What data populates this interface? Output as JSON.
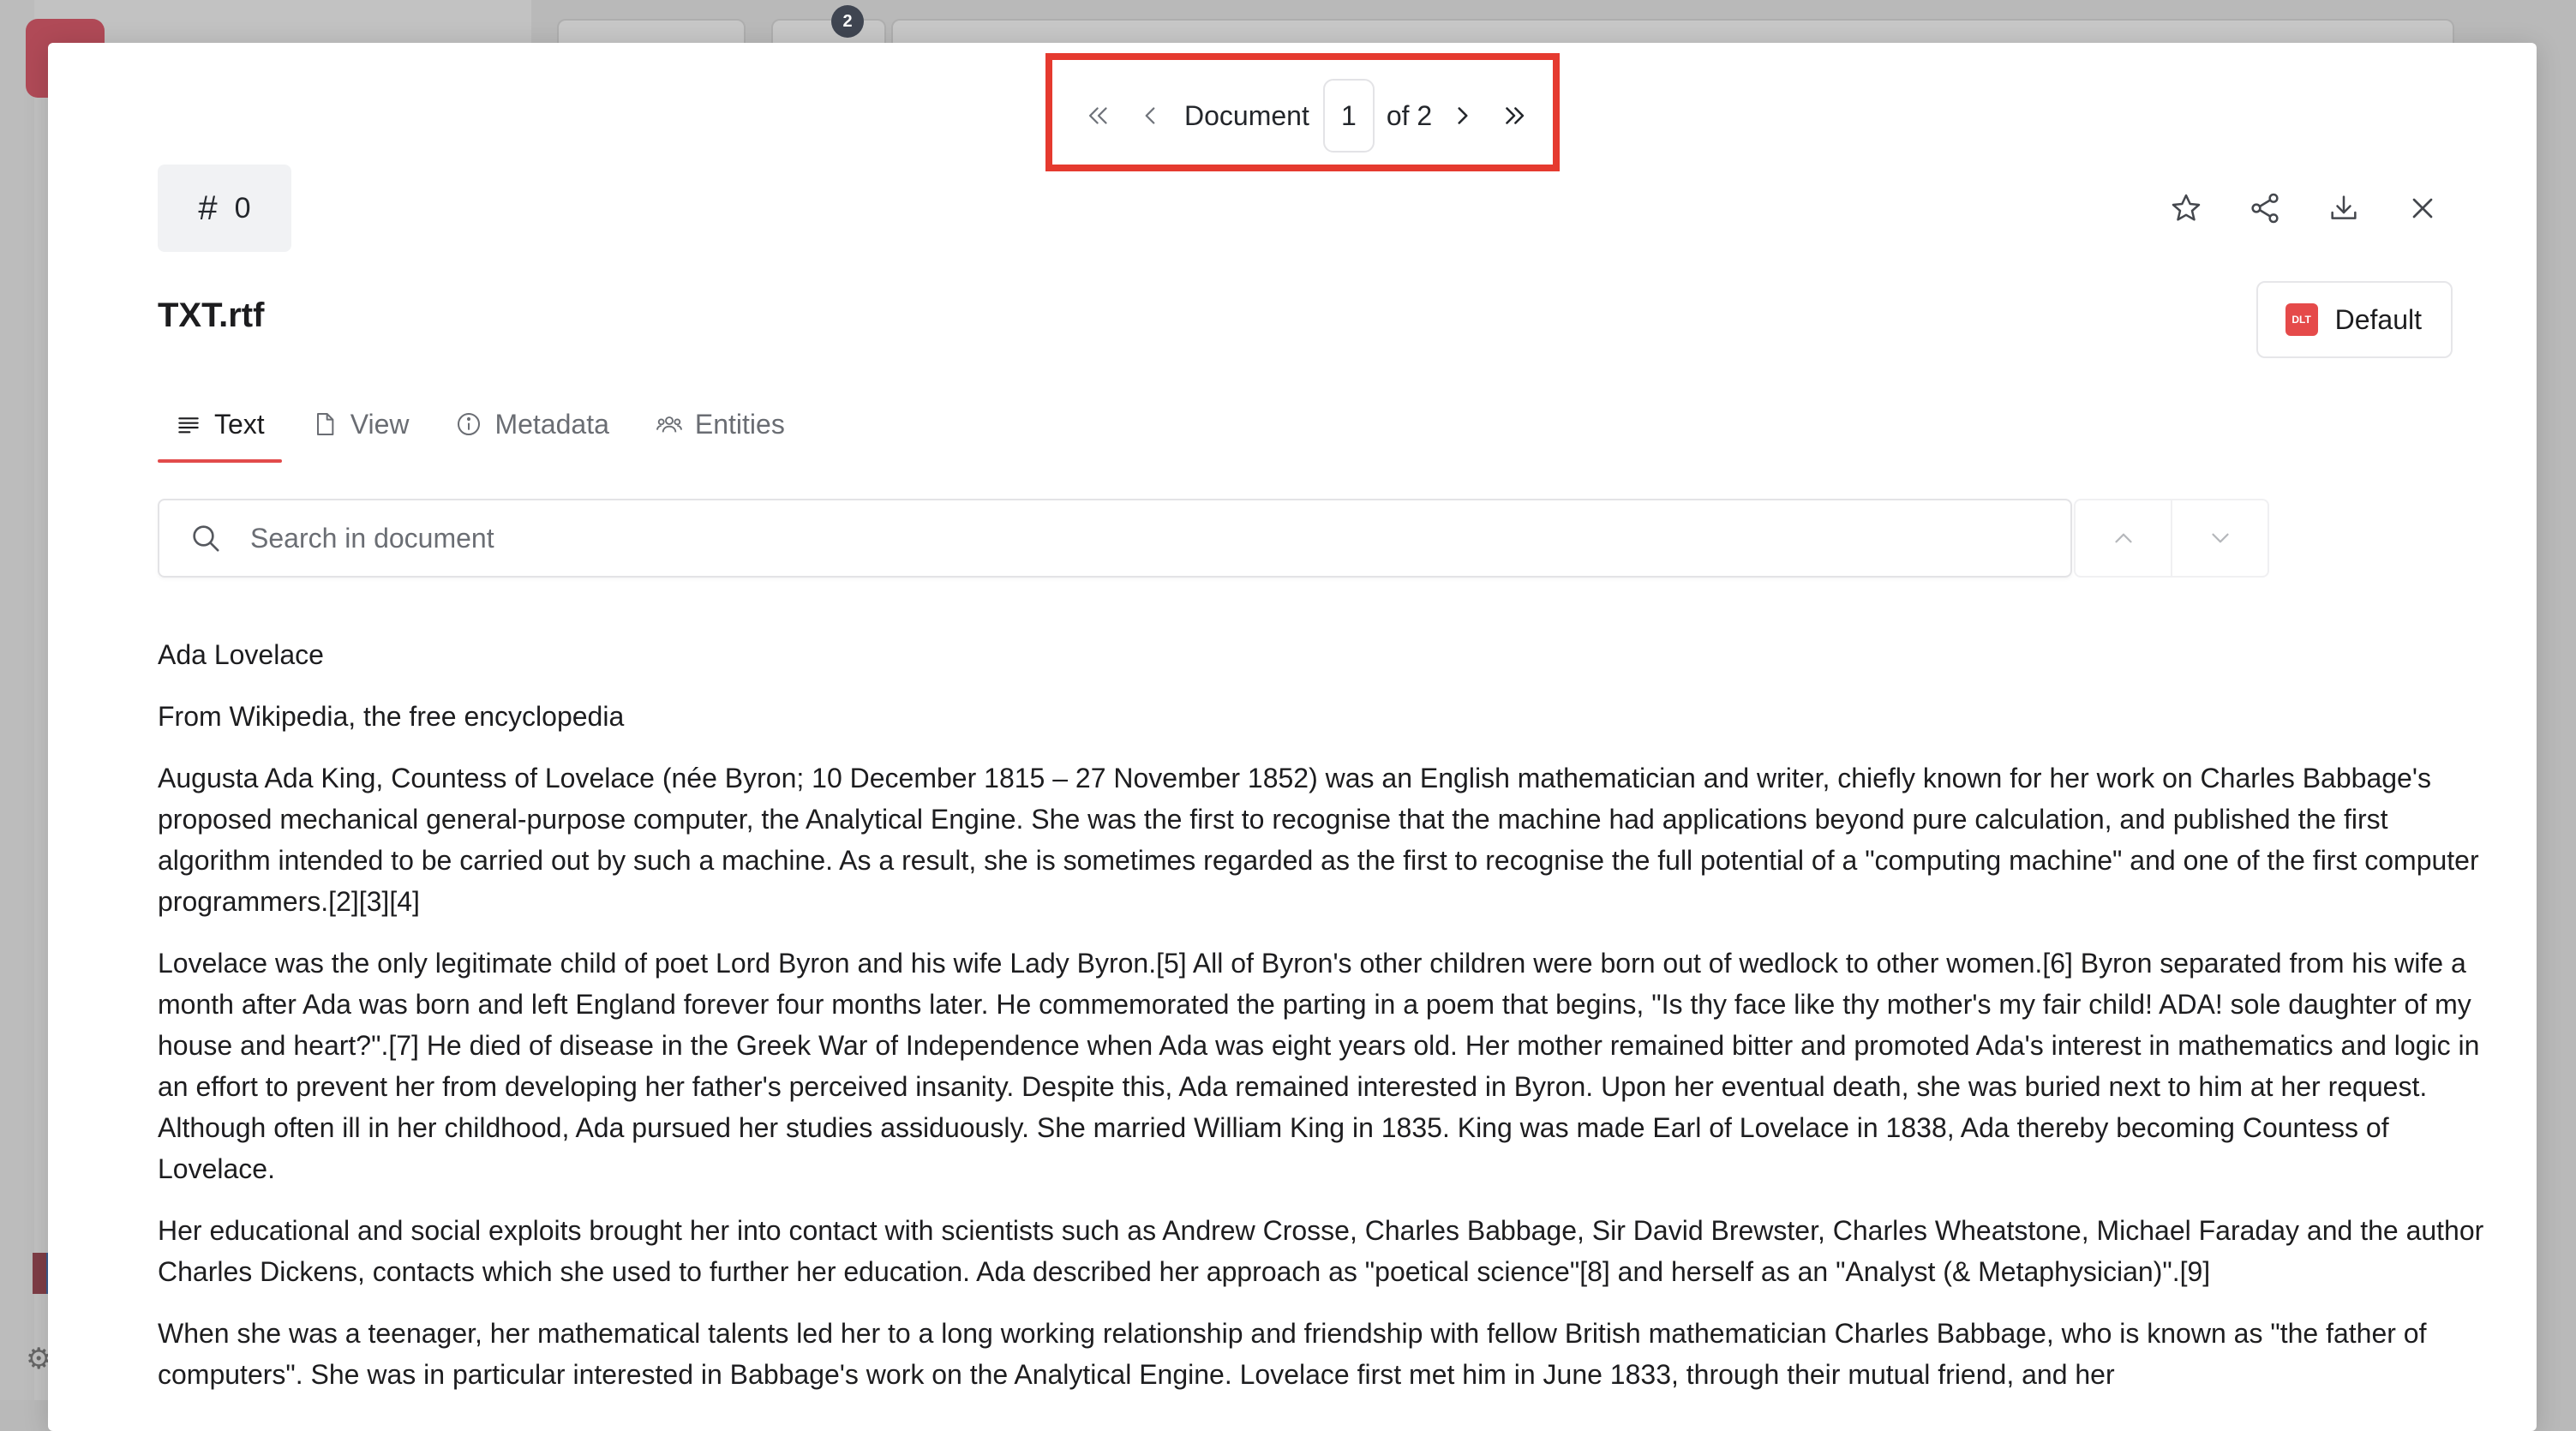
{
  "background": {
    "badge_count": "2"
  },
  "modal": {
    "pager": {
      "document_label": "Document",
      "current_page": "1",
      "of_label": "of 2"
    },
    "id_chip": {
      "hash": "#",
      "value": "0"
    },
    "title": "TXT.rtf",
    "default_button": {
      "badge": "DLT",
      "label": "Default"
    },
    "tabs": [
      {
        "label": "Text",
        "icon": "text-lines-icon"
      },
      {
        "label": "View",
        "icon": "file-icon"
      },
      {
        "label": "Metadata",
        "icon": "info-icon"
      },
      {
        "label": "Entities",
        "icon": "users-icon"
      }
    ],
    "search": {
      "placeholder": "Search in document"
    },
    "content": [
      "Ada Lovelace",
      "From Wikipedia, the free encyclopedia",
      "Augusta Ada King, Countess of Lovelace (née Byron; 10 December 1815 – 27 November 1852) was an English mathematician and writer, chiefly known for her work on Charles Babbage's proposed mechanical general-purpose computer, the Analytical Engine. She was the first to recognise that the machine had applications beyond pure calculation, and published the first algorithm intended to be carried out by such a machine. As a result, she is sometimes regarded as the first to recognise the full potential of a \"computing machine\" and one of the first computer programmers.[2][3][4]",
      "Lovelace was the only legitimate child of poet Lord Byron and his wife Lady Byron.[5] All of Byron's other children were born out of wedlock to other women.[6] Byron separated from his wife a month after Ada was born and left England forever four months later. He commemorated the parting in a poem that begins, \"Is thy face like thy mother's my fair child! ADA! sole daughter of my house and heart?\".[7] He died of disease in the Greek War of Independence when Ada was eight years old. Her mother remained bitter and promoted Ada's interest in mathematics and logic in an effort to prevent her from developing her father's perceived insanity. Despite this, Ada remained interested in Byron. Upon her eventual death, she was buried next to him at her request. Although often ill in her childhood, Ada pursued her studies assiduously. She married William King in 1835. King was made Earl of Lovelace in 1838, Ada thereby becoming Countess of Lovelace.",
      "Her educational and social exploits brought her into contact with scientists such as Andrew Crosse, Charles Babbage, Sir David Brewster, Charles Wheatstone, Michael Faraday and the author Charles Dickens, contacts which she used to further her education. Ada described her approach as \"poetical science\"[8] and herself as an \"Analyst (& Metaphysician)\".[9]",
      "When she was a teenager, her mathematical talents led her to a long working relationship and friendship with fellow British mathematician Charles Babbage, who is known as \"the father of computers\". She was in particular interested in Babbage's work on the Analytical Engine. Lovelace first met him in June 1833, through their mutual friend, and her"
    ]
  }
}
